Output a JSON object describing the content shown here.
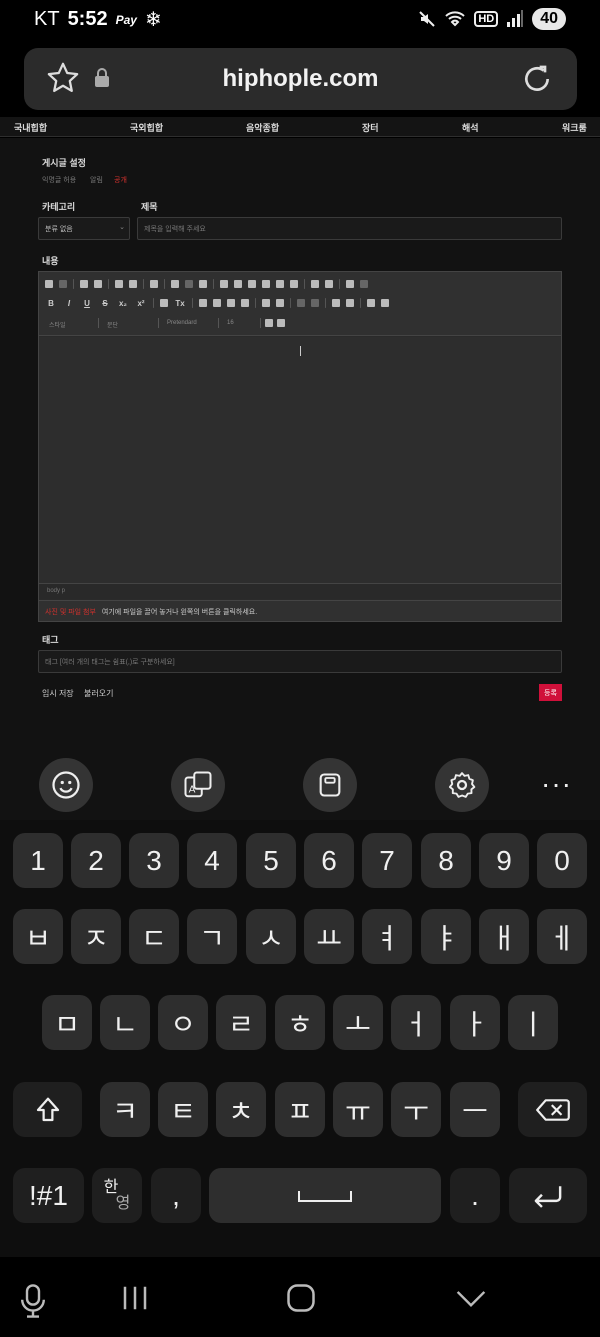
{
  "status_bar": {
    "carrier": "KT",
    "time": "5:52",
    "app_mark": "Pay",
    "battery": "40",
    "network": "HD"
  },
  "browser": {
    "url": "hiphople.com"
  },
  "site_nav": [
    "국내힙합",
    "국외힙합",
    "음악종합",
    "장터",
    "해석",
    "워크룸"
  ],
  "post_settings": {
    "title": "게시글 설정",
    "options": [
      "익명글 허용",
      "알림",
      "공개"
    ]
  },
  "category": {
    "label": "카테고리",
    "value": "분류 없음"
  },
  "subject": {
    "label": "제목",
    "placeholder": "제목을 입력해 주세요"
  },
  "content": {
    "label": "내용",
    "style_combo": "스타일",
    "format_combo": "문단",
    "font_combo": "Pretendard",
    "size_combo": "16",
    "path": "body  p",
    "attach_red": "사진 및 파일 첨부",
    "attach_hint": "여기에 파일을 끌어 놓거나 왼쪽의 버튼을 클릭하세요."
  },
  "tags": {
    "label": "태그",
    "placeholder": "태그 [여러 개의 태그는 쉼표(,)로 구분하세요]"
  },
  "actions": {
    "temp_save": "임시 저장",
    "load": "불러오기",
    "submit": "등록"
  },
  "keyboard": {
    "row_numbers": [
      "1",
      "2",
      "3",
      "4",
      "5",
      "6",
      "7",
      "8",
      "9",
      "0"
    ],
    "row1": [
      "ㅂ",
      "ㅈ",
      "ㄷ",
      "ㄱ",
      "ㅅ",
      "ㅛ",
      "ㅕ",
      "ㅑ",
      "ㅐ",
      "ㅔ"
    ],
    "row2": [
      "ㅁ",
      "ㄴ",
      "ㅇ",
      "ㄹ",
      "ㅎ",
      "ㅗ",
      "ㅓ",
      "ㅏ",
      "ㅣ"
    ],
    "row3": [
      "ㅋ",
      "ㅌ",
      "ㅊ",
      "ㅍ",
      "ㅠ",
      "ㅜ",
      "ㅡ"
    ],
    "symbols": "!#1",
    "lang_top": "한",
    "lang_bottom": "영",
    "comma": ",",
    "period": "."
  }
}
